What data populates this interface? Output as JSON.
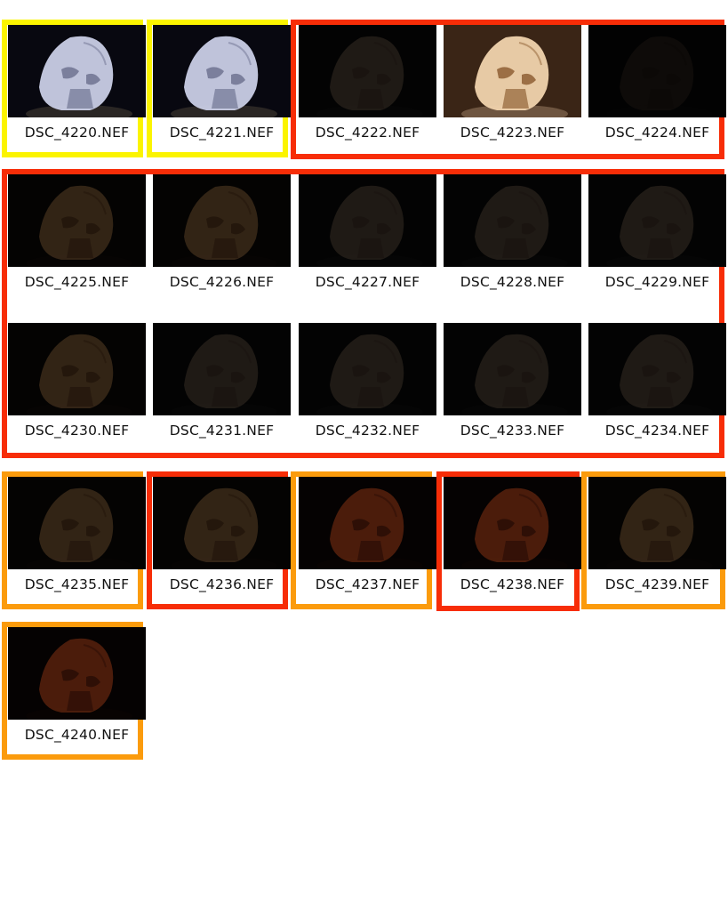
{
  "colors": {
    "yellow": "#fbf400",
    "red": "#f72d07",
    "orange": "#fb9b0c"
  },
  "thumbnails": [
    {
      "file": "DSC_4220.NEF",
      "tone": "bright-cool",
      "group_color": "yellow"
    },
    {
      "file": "DSC_4221.NEF",
      "tone": "bright-cool",
      "group_color": "yellow"
    },
    {
      "file": "DSC_4222.NEF",
      "tone": "dark-neutral",
      "group_color": "red"
    },
    {
      "file": "DSC_4223.NEF",
      "tone": "bright-warm",
      "group_color": "red"
    },
    {
      "file": "DSC_4224.NEF",
      "tone": "very-dark",
      "group_color": "red"
    },
    {
      "file": "DSC_4225.NEF",
      "tone": "dark-warm",
      "group_color": "red"
    },
    {
      "file": "DSC_4226.NEF",
      "tone": "dark-warm",
      "group_color": "red"
    },
    {
      "file": "DSC_4227.NEF",
      "tone": "dark-neutral",
      "group_color": "red"
    },
    {
      "file": "DSC_4228.NEF",
      "tone": "dark-neutral",
      "group_color": "red"
    },
    {
      "file": "DSC_4229.NEF",
      "tone": "dark-neutral",
      "group_color": "red"
    },
    {
      "file": "DSC_4230.NEF",
      "tone": "dark-warm",
      "group_color": "red"
    },
    {
      "file": "DSC_4231.NEF",
      "tone": "dark-neutral",
      "group_color": "red"
    },
    {
      "file": "DSC_4232.NEF",
      "tone": "dark-neutral",
      "group_color": "red"
    },
    {
      "file": "DSC_4233.NEF",
      "tone": "dark-neutral",
      "group_color": "red"
    },
    {
      "file": "DSC_4234.NEF",
      "tone": "dark-neutral",
      "group_color": "red"
    },
    {
      "file": "DSC_4235.NEF",
      "tone": "dark-warm",
      "group_color": "orange"
    },
    {
      "file": "DSC_4236.NEF",
      "tone": "dark-warm",
      "group_color": "red"
    },
    {
      "file": "DSC_4237.NEF",
      "tone": "dark-red",
      "group_color": "orange"
    },
    {
      "file": "DSC_4238.NEF",
      "tone": "dark-red",
      "group_color": "red"
    },
    {
      "file": "DSC_4239.NEF",
      "tone": "dark-warm",
      "group_color": "orange"
    },
    {
      "file": "DSC_4240.NEF",
      "tone": "dark-red",
      "group_color": "orange"
    }
  ]
}
